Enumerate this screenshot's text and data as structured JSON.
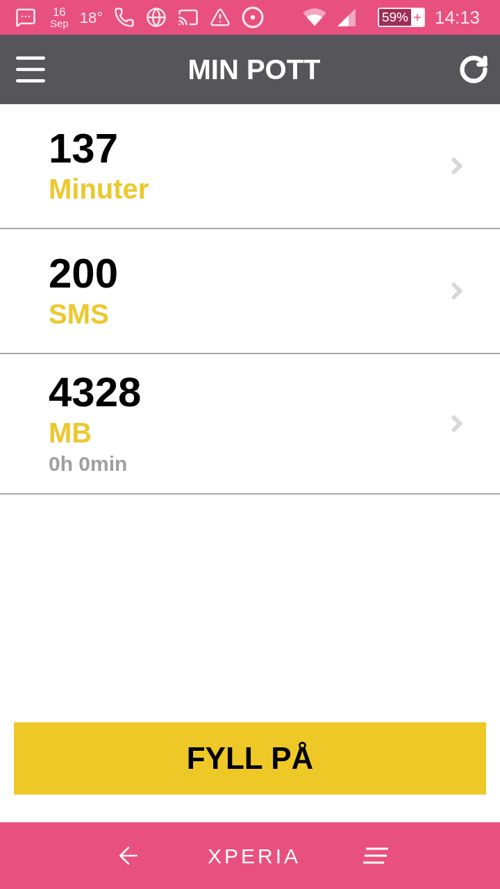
{
  "status_bar": {
    "date_day": "16",
    "date_month": "Sep",
    "temperature": "18°",
    "battery": "59%",
    "time": "14:13"
  },
  "header": {
    "title": "MIN POTT"
  },
  "items": [
    {
      "value": "137",
      "unit": "Minuter"
    },
    {
      "value": "200",
      "unit": "SMS"
    },
    {
      "value": "4328",
      "unit": "MB",
      "detail": "0h 0min"
    }
  ],
  "button": "FYLL PÅ",
  "nav_bar": {
    "brand": "XPERIA"
  }
}
